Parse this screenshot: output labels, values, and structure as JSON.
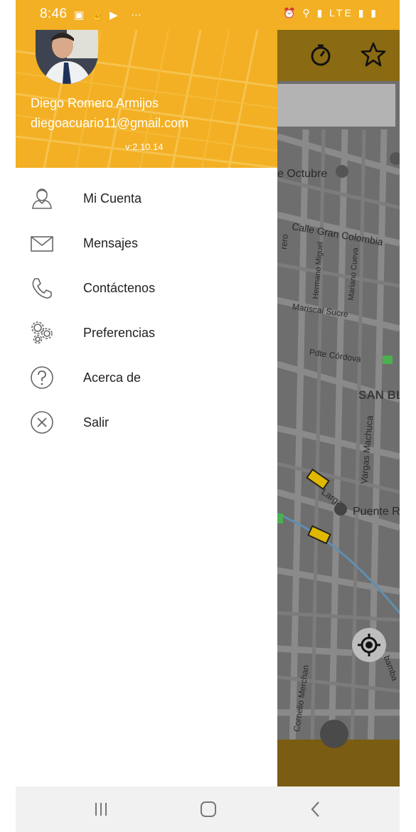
{
  "status_bar": {
    "time": "8:46",
    "right_icons": "⏰ ⚲ ▮ LTE ▮ ▮"
  },
  "user": {
    "name": "Diego Romero Armijos",
    "email": "diegoacuario11@gmail.com",
    "version": "v:2.10.14"
  },
  "menu": [
    {
      "label": "Mi Cuenta",
      "icon": "user-icon"
    },
    {
      "label": "Mensajes",
      "icon": "envelope-icon"
    },
    {
      "label": "Contáctenos",
      "icon": "phone-icon"
    },
    {
      "label": "Preferencias",
      "icon": "gears-icon"
    },
    {
      "label": "Acerca de",
      "icon": "help-icon"
    },
    {
      "label": "Salir",
      "icon": "close-circle-icon"
    }
  ],
  "map": {
    "labels": {
      "octubre": "e Octubre",
      "gran_colombia": "Calle Gran Colombia",
      "borrero": "rero",
      "hermano_miguel": "Hermano Miguel",
      "mariano_cueva": "Mariano Cueva",
      "mariscal_sucre": "Mariscal Sucre",
      "pdte_cordova": "Pdte Córdova",
      "san_blas": "SAN BL",
      "vargas_machuca": "Vargas Machuca",
      "puente": "Puente R",
      "larga": "Larga",
      "cornelio": "Cornelio Merchan",
      "bamba": "bamba"
    }
  },
  "colors": {
    "accent": "#f3b024",
    "header_dark": "#8a6a12"
  }
}
